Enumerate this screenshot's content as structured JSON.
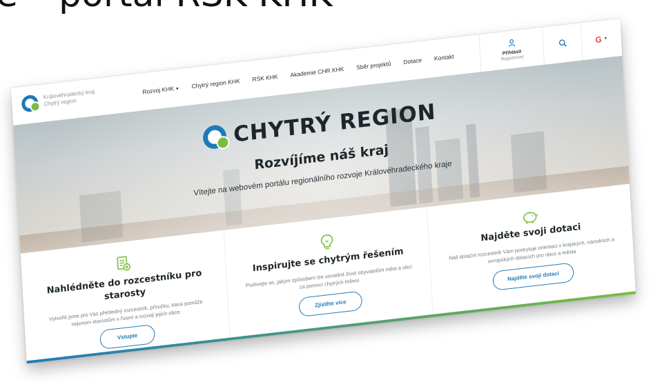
{
  "slide": {
    "title": "e – portál RSK KHK"
  },
  "site": {
    "brand_line1": "Královéhradecký kraj",
    "brand_line2": "Chytrý region",
    "nav": {
      "items": [
        {
          "label": "Rozvoj KHK",
          "dropdown": true
        },
        {
          "label": "Chytrý region KHK"
        },
        {
          "label": "RSK KHK"
        },
        {
          "label": "Akademie CHR KHK"
        },
        {
          "label": "Sběr projektů"
        },
        {
          "label": "Dotace"
        },
        {
          "label": "Kontakt"
        }
      ],
      "login_label": "Přihlásit",
      "register_label": "Registrovat",
      "lang": "G"
    },
    "hero": {
      "logo_text": "CHYTRÝ REGION",
      "headline": "Rozvíjíme náš kraj",
      "subtitle": "Vítejte na webovém portálu regionálního rozvoje Královéhradeckého kraje"
    },
    "cards": [
      {
        "title": "Nahlédněte do rozcestníku pro starosty",
        "text": "Vytvořili jsme pro Vás přehledný rozcestník, příručku, která pomůže nejenom starostům v řízení a rozvoji jejich obce.",
        "button": "Vstupte",
        "icon": "document-plus-icon"
      },
      {
        "title": "Inspirujte se chytrým řešením",
        "text": "Podívejte se, jakým způsobem lze usnadnit život obyvatelům měst a obcí za pomoci chytrých řešení",
        "button": "Zjistěte více",
        "icon": "lightbulb-icon"
      },
      {
        "title": "Najděte svoji dotaci",
        "text": "Náš dotační rozcestník Vám poskytuje orientaci v krajských, národních a evropských dotacích pro obce a města",
        "button": "Najděte svoji dotaci",
        "icon": "piggy-bank-icon"
      }
    ]
  },
  "colors": {
    "brand_blue": "#1f7ab8",
    "brand_green": "#79bd3e",
    "text_dark": "#1d262b"
  }
}
